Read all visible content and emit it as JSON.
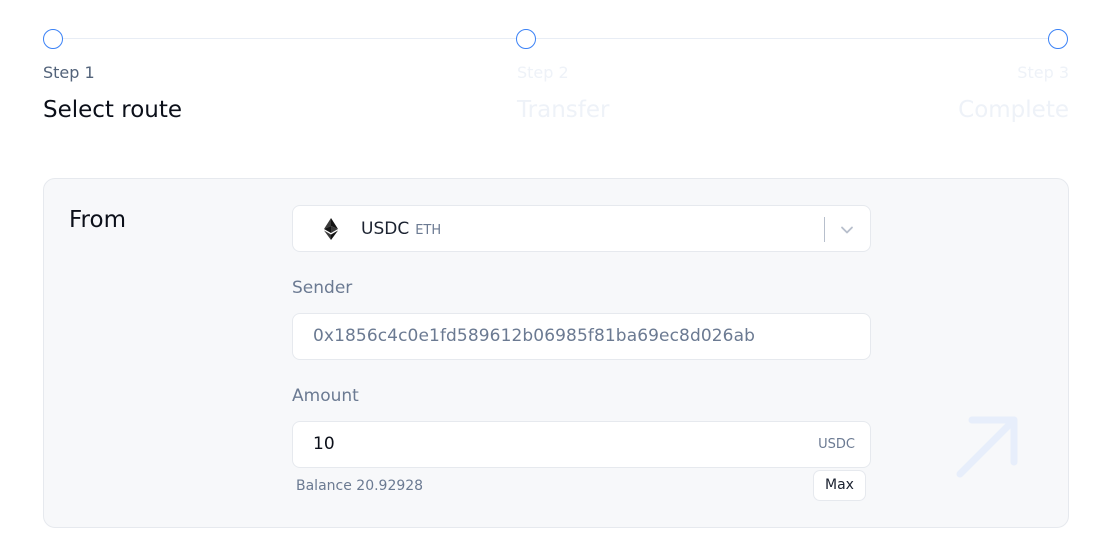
{
  "stepper": {
    "steps": [
      {
        "label": "Step 1",
        "title": "Select route",
        "state": "active"
      },
      {
        "label": "Step 2",
        "title": "Transfer",
        "state": "inactive"
      },
      {
        "label": "Step 3",
        "title": "Complete",
        "state": "inactive"
      }
    ]
  },
  "from_section": {
    "title": "From",
    "token_select": {
      "token": "USDC",
      "chain": "ETH",
      "icon": "ethereum-icon"
    },
    "sender": {
      "label": "Sender",
      "value": "0x1856c4c0e1fd589612b06985f81ba69ec8d026ab"
    },
    "amount": {
      "label": "Amount",
      "value": "10",
      "unit": "USDC"
    },
    "balance_text": "Balance 20.92928",
    "max_label": "Max"
  },
  "colors": {
    "accent": "#3b82f6",
    "card_background": "#f7f8fa",
    "muted_text": "#6b7a92"
  }
}
